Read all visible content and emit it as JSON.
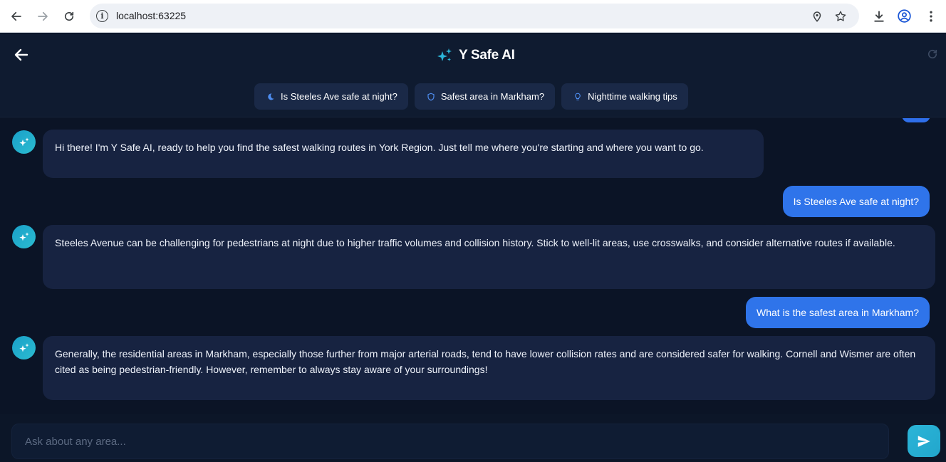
{
  "browser": {
    "url": "localhost:63225",
    "back_icon": "arrow-left-icon",
    "forward_icon": "arrow-right-icon",
    "reload_icon": "reload-icon"
  },
  "header": {
    "title": "Y Safe AI",
    "title_icon": "sparkle-icon",
    "back_icon": "arrow-left-icon",
    "refresh_icon": "refresh-icon"
  },
  "chips": [
    {
      "label": "Is Steeles Ave safe at night?",
      "icon": "moon-icon"
    },
    {
      "label": "Safest area in Markham?",
      "icon": "shield-icon"
    },
    {
      "label": "Nighttime walking tips",
      "icon": "lightbulb-icon"
    }
  ],
  "messages": [
    {
      "role": "assistant",
      "text": "Hi there! I'm Y Safe AI, ready to help you find the safest walking routes in York Region. Just tell me where you're starting and where you want to go."
    },
    {
      "role": "user",
      "text": "Is Steeles Ave safe at night?"
    },
    {
      "role": "assistant",
      "text": "Steeles Avenue can be challenging for pedestrians at night due to higher traffic volumes and collision history. Stick to well-lit areas, use crosswalks, and consider alternative routes if available."
    },
    {
      "role": "user",
      "text": "What is the safest area in Markham?"
    },
    {
      "role": "assistant",
      "text": "Generally, the residential areas in Markham, especially those further from major arterial roads, tend to have lower collision rates and are considered safer for walking. Cornell and Wismer are often cited as being pedestrian-friendly. However, remember to always stay aware of your surroundings!"
    }
  ],
  "input": {
    "placeholder": "Ask about any area...",
    "value": ""
  },
  "colors": {
    "background": "#0b1426",
    "bot_bubble": "#172341",
    "user_bubble": "#2f74ea",
    "accent": "#22a6cc"
  }
}
